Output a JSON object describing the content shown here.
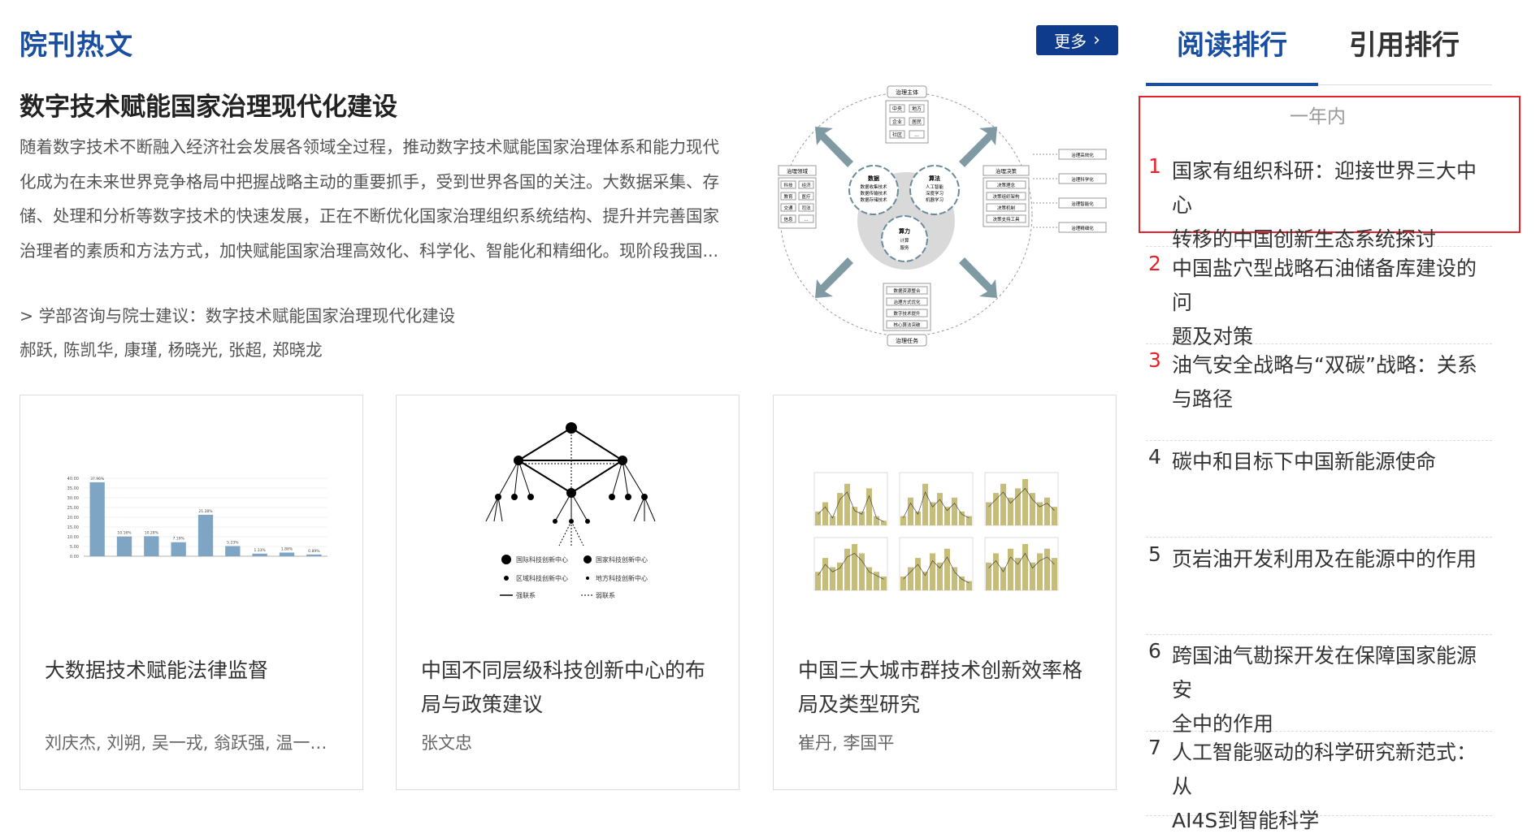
{
  "section": {
    "title": "院刊热文",
    "more_label": "更多"
  },
  "featured": {
    "title": "数字技术赋能国家治理现代化建设",
    "abstract_lines": [
      "随着数字技术不断融入经济社会发展各领域全过程，推动数字技术赋能国家治理体系和能力现代",
      "化成为在未来世界竞争格局中把握战略主动的重要抓手，受到世界各国的关注。大数据采集、存",
      "储、处理和分析等数字技术的快速发展，正在不断优化国家治理组织系统结构、提升并完善国家",
      "治理者的素质和方法方式，加快赋能国家治理高效化、科学化、智能化和精细化。现阶段我国..."
    ],
    "link": "> 学部咨询与院士建议：数字技术赋能国家治理现代化建设",
    "authors": "郝跃, 陈凯华, 康瑾, 杨晓光, 张超, 郑晓龙",
    "figure": {
      "top": "治理主体",
      "top_items": [
        "中央",
        "地方",
        "企业",
        "居民",
        "社区",
        "..."
      ],
      "left": "治理领域",
      "left_items": [
        "科技",
        "经济",
        "教育",
        "医疗",
        "交通",
        "司法",
        "信息",
        "..."
      ],
      "gear1": "数据",
      "gear1_items": [
        "数据收集技术",
        "数据传输技术",
        "数据存储技术"
      ],
      "gear2": "算法",
      "gear2_items": [
        "人工智能",
        "深度学习",
        "机器学习"
      ],
      "gear3": "算力",
      "gear3_items": [
        "计算",
        "服务"
      ],
      "right": "治理决策",
      "right_items": [
        "决策理念",
        "决策组织架构",
        "决策机制",
        "决策支持工具"
      ],
      "far_right": [
        "治理高效化",
        "治理科学化",
        "治理智能化",
        "治理精细化"
      ],
      "bottom_items": [
        "数据资源整合",
        "治理方式优化",
        "数字技术提升",
        "核心算法突破"
      ],
      "bottom": "治理任务"
    }
  },
  "cards": [
    {
      "title_lines": [
        "大数据技术赋能法律监督"
      ],
      "authors": "刘庆杰, 刘朔, 吴一戎, 翁跃强, 温一浩...",
      "chart_data": {
        "type": "bar",
        "values": [
          37.96,
          10.16,
          10.28,
          7.19,
          21.28,
          5.23,
          1.33,
          1.88,
          0.89
        ],
        "labels": [
          "37.96%",
          "10.16%",
          "10.28%",
          "7.19%",
          "21.28%",
          "5.23%",
          "1.33%",
          "1.88%",
          "0.89%"
        ],
        "ylim": [
          0,
          40
        ],
        "yticks": [
          "40.00",
          "35.00",
          "30.00",
          "25.00",
          "20.00",
          "15.00",
          "10.00",
          "5.00",
          "0.00"
        ]
      }
    },
    {
      "title_lines": [
        "中国不同层级科技创新中心的布",
        "局与政策建议"
      ],
      "authors": "张文忠",
      "legend": [
        "国际科技创新中心",
        "国家科技创新中心",
        "区域科技创新中心",
        "地方科技创新中心",
        "强联系",
        "弱联系"
      ]
    },
    {
      "title_lines": [
        "中国三大城市群技术创新效率格",
        "局及类型研究"
      ],
      "authors": "崔丹, 李国平"
    }
  ],
  "ranking": {
    "tabs": [
      "阅读排行",
      "引用排行"
    ],
    "period": "一年内",
    "items": [
      {
        "num": "1",
        "lines": [
          "国家有组织科研：迎接世界三大中心",
          "转移的中国创新生态系统探讨"
        ]
      },
      {
        "num": "2",
        "lines": [
          "中国盐穴型战略石油储备库建设的问",
          "题及对策"
        ]
      },
      {
        "num": "3",
        "lines": [
          "油气安全战略与“双碳”战略：关系",
          "与路径"
        ]
      },
      {
        "num": "4",
        "lines": [
          "碳中和目标下中国新能源使命"
        ]
      },
      {
        "num": "5",
        "lines": [
          "页岩油开发利用及在能源中的作用"
        ]
      },
      {
        "num": "6",
        "lines": [
          "跨国油气勘探开发在保障国家能源安",
          "全中的作用"
        ]
      },
      {
        "num": "7",
        "lines": [
          "人工智能驱动的科学研究新范式：从",
          "AI4S到智能科学"
        ]
      }
    ],
    "colors": {
      "top3": "#e8202a",
      "rest": "#333333"
    }
  }
}
